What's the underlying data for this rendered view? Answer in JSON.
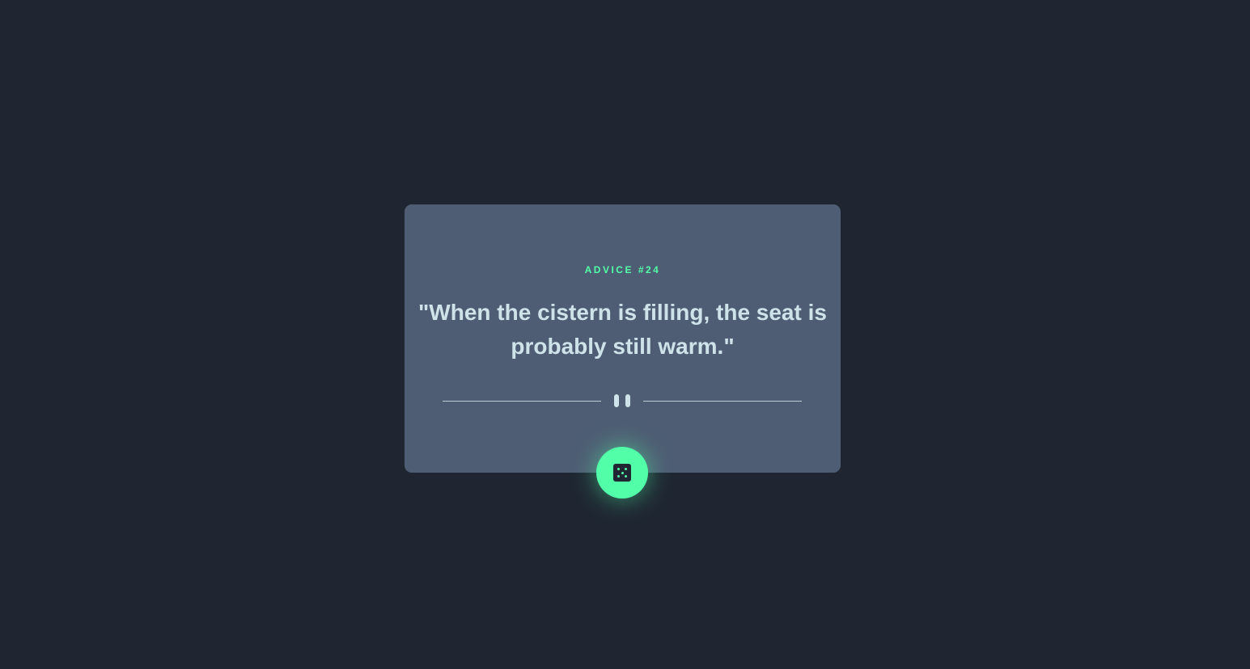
{
  "card": {
    "advice_label": "ADVICE #24",
    "quote": "\"When the cistern is filling, the seat is probably still warm.\""
  },
  "divider": {
    "icon": "pause-icon"
  },
  "button": {
    "icon": "dice-icon"
  },
  "colors": {
    "background": "#1f2632",
    "card": "#4e5d73",
    "accent": "#52ffa8",
    "text": "#cee3e9"
  }
}
